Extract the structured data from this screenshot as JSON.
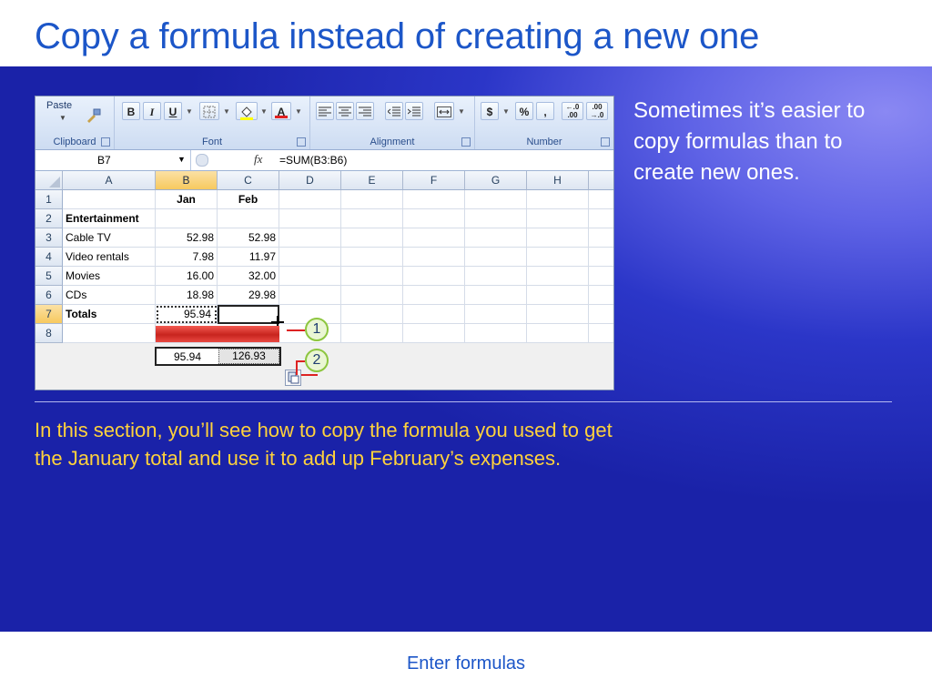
{
  "title": "Copy a formula instead of creating a new one",
  "side_text": "Sometimes it’s easier to copy formulas than to create new ones.",
  "intro_text": "In this section, you’ll see how to copy the formula you used to get the January total and use it to add up February’s expenses.",
  "footer": "Enter formulas",
  "colors": {
    "title": "#1c56c8",
    "panel": "#2b36c8",
    "intro_text": "#ffd23c",
    "highlight": "#e53a3a",
    "callout": "#8dc63f"
  },
  "ribbon": {
    "clipboard": {
      "label": "Clipboard",
      "paste": "Paste"
    },
    "font": {
      "label": "Font",
      "bold": "B",
      "italic": "I",
      "underline": "U",
      "font_color": "A"
    },
    "alignment": {
      "label": "Alignment"
    },
    "number": {
      "label": "Number",
      "currency": "$",
      "percent": "%",
      "comma": ",",
      "inc_decimal": "←.0 .00",
      "dec_decimal": ".00 →.0"
    }
  },
  "formula_bar": {
    "name_box": "B7",
    "fx": "fx",
    "formula": "=SUM(B3:B6)"
  },
  "sheet": {
    "columns": [
      "A",
      "B",
      "C",
      "D",
      "E",
      "F",
      "G",
      "H"
    ],
    "rows": [
      "1",
      "2",
      "3",
      "4",
      "5",
      "6",
      "7",
      "8"
    ],
    "cells": [
      [
        "",
        "Jan",
        "Feb"
      ],
      [
        "Entertainment",
        "",
        ""
      ],
      [
        "Cable TV",
        "52.98",
        "52.98"
      ],
      [
        "Video rentals",
        "7.98",
        "11.97"
      ],
      [
        "Movies",
        "16.00",
        "32.00"
      ],
      [
        "CDs",
        "18.98",
        "29.98"
      ],
      [
        "Totals",
        "95.94",
        ""
      ],
      [
        "",
        "",
        ""
      ]
    ],
    "copied_totals": [
      "95.94",
      "126.93"
    ]
  },
  "callouts": [
    "1",
    "2"
  ]
}
